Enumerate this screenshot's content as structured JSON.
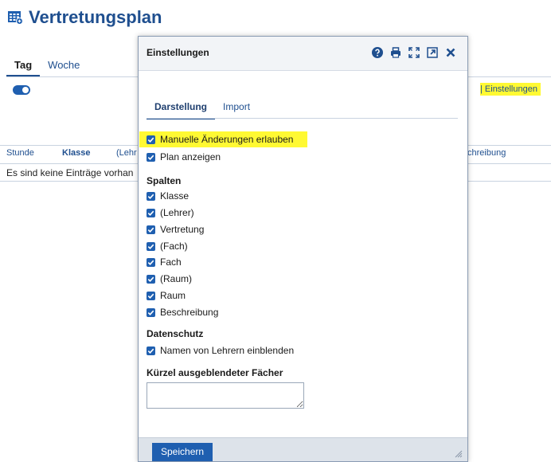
{
  "page": {
    "title": "Vertretungsplan",
    "tabs": [
      "Tag",
      "Woche"
    ],
    "settings_link": "| Einstellungen",
    "table": {
      "headers": [
        "Stunde",
        "Klasse",
        "(Lehr",
        "chreibung"
      ],
      "empty_text": "Es sind keine Einträge vorhan"
    }
  },
  "modal": {
    "title": "Einstellungen",
    "tools": [
      "help-icon",
      "print-icon",
      "fullscreen-icon",
      "popout-icon",
      "close-icon"
    ],
    "tabs": [
      "Darstellung",
      "Import"
    ],
    "options": [
      {
        "label": "Manuelle Änderungen erlauben",
        "checked": true
      },
      {
        "label": "Plan anzeigen",
        "checked": true
      }
    ],
    "sections": {
      "columns": "Spalten",
      "privacy": "Datenschutz",
      "hidden_subjects": "Kürzel ausgeblendeter Fächer"
    },
    "columns": [
      {
        "label": "Klasse",
        "checked": true
      },
      {
        "label": "(Lehrer)",
        "checked": true
      },
      {
        "label": "Vertretung",
        "checked": true
      },
      {
        "label": "(Fach)",
        "checked": true
      },
      {
        "label": "Fach",
        "checked": true
      },
      {
        "label": "(Raum)",
        "checked": true
      },
      {
        "label": "Raum",
        "checked": true
      },
      {
        "label": "Beschreibung",
        "checked": true
      }
    ],
    "privacy_options": [
      {
        "label": "Namen von Lehrern einblenden",
        "checked": true
      }
    ],
    "hidden_subjects_value": "",
    "save_label": "Speichern"
  },
  "colors": {
    "primary": "#1f5fb0",
    "title": "#1f4f8f",
    "highlight": "#fff933"
  }
}
